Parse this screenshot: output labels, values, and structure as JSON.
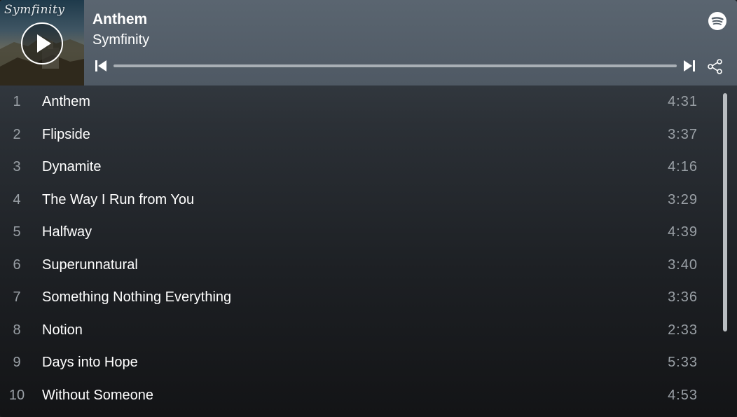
{
  "now_playing": {
    "title": "Anthem",
    "artist": "Symfinity",
    "progress_fraction": 0.0
  },
  "cover": {
    "title_text": "Symfinity"
  },
  "icons": {
    "play": "play-icon",
    "spotify": "spotify-logo-icon",
    "previous": "skip-previous-icon",
    "next": "skip-next-icon",
    "share": "share-icon"
  },
  "colors": {
    "header_bg": "#56616b",
    "list_bg_top": "#3f474f",
    "list_bg_bottom": "#131416",
    "text_primary": "#ffffff",
    "text_secondary": "#9aa0a6"
  },
  "tracks": [
    {
      "num": "1",
      "title": "Anthem",
      "duration": "4:31"
    },
    {
      "num": "2",
      "title": "Flipside",
      "duration": "3:37"
    },
    {
      "num": "3",
      "title": "Dynamite",
      "duration": "4:16"
    },
    {
      "num": "4",
      "title": "The Way I Run from You",
      "duration": "3:29"
    },
    {
      "num": "5",
      "title": "Halfway",
      "duration": "4:39"
    },
    {
      "num": "6",
      "title": "Superunnatural",
      "duration": "3:40"
    },
    {
      "num": "7",
      "title": "Something Nothing Everything",
      "duration": "3:36"
    },
    {
      "num": "8",
      "title": "Notion",
      "duration": "2:33"
    },
    {
      "num": "9",
      "title": "Days into Hope",
      "duration": "5:33"
    },
    {
      "num": "10",
      "title": "Without Someone",
      "duration": "4:53"
    }
  ]
}
